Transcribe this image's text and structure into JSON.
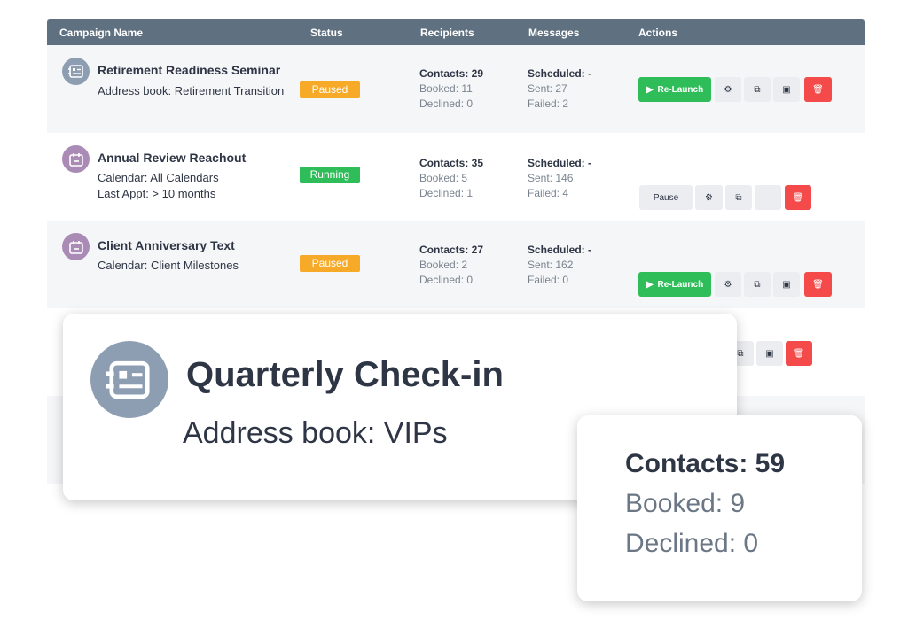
{
  "header": {
    "campaign_name": "Campaign Name",
    "status": "Status",
    "recipients": "Recipients",
    "messages": "Messages",
    "actions": "Actions"
  },
  "rows": [
    {
      "icon": "address-card-icon",
      "name": "Retirement Readiness Seminar",
      "sub1": "Address book: Retirement Transition",
      "sub2": "",
      "status": "Paused",
      "contacts": "Contacts: 29",
      "booked": "Booked: 11",
      "declined": "Declined: 0",
      "scheduled": "Scheduled: -",
      "sent": "Sent: 27",
      "failed": "Failed: 2",
      "primary_action": "Re-Launch"
    },
    {
      "icon": "calendar-icon",
      "name": "Annual Review Reachout",
      "sub1": "Calendar: All Calendars",
      "sub2": "Last Appt: > 10 months",
      "status": "Running",
      "contacts": "Contacts: 35",
      "booked": "Booked: 5",
      "declined": "Declined: 1",
      "scheduled": "Scheduled: -",
      "sent": "Sent: 146",
      "failed": "Failed: 4",
      "primary_action": "Pause"
    },
    {
      "icon": "calendar-icon",
      "name": "Client Anniversary Text",
      "sub1": "Calendar: Client Milestones",
      "sub2": "",
      "status": "Paused",
      "contacts": "Contacts: 27",
      "booked": "Booked: 2",
      "declined": "Declined: 0",
      "scheduled": "Scheduled: -",
      "sent": "Sent: 162",
      "failed": "Failed: 0",
      "primary_action": "Re-Launch"
    }
  ],
  "zoom_card": {
    "icon": "address-card-icon",
    "name": "Quarterly Check-in",
    "sub": "Address book: VIPs"
  },
  "stats_card": {
    "contacts": "Contacts: 59",
    "booked": "Booked: 9",
    "declined": "Declined: 0"
  },
  "colors": {
    "header_bg": "#5f7180",
    "paused": "#f7a928",
    "running": "#2ebd58",
    "relaunch": "#2ebd58",
    "delete": "#f44a4a"
  }
}
